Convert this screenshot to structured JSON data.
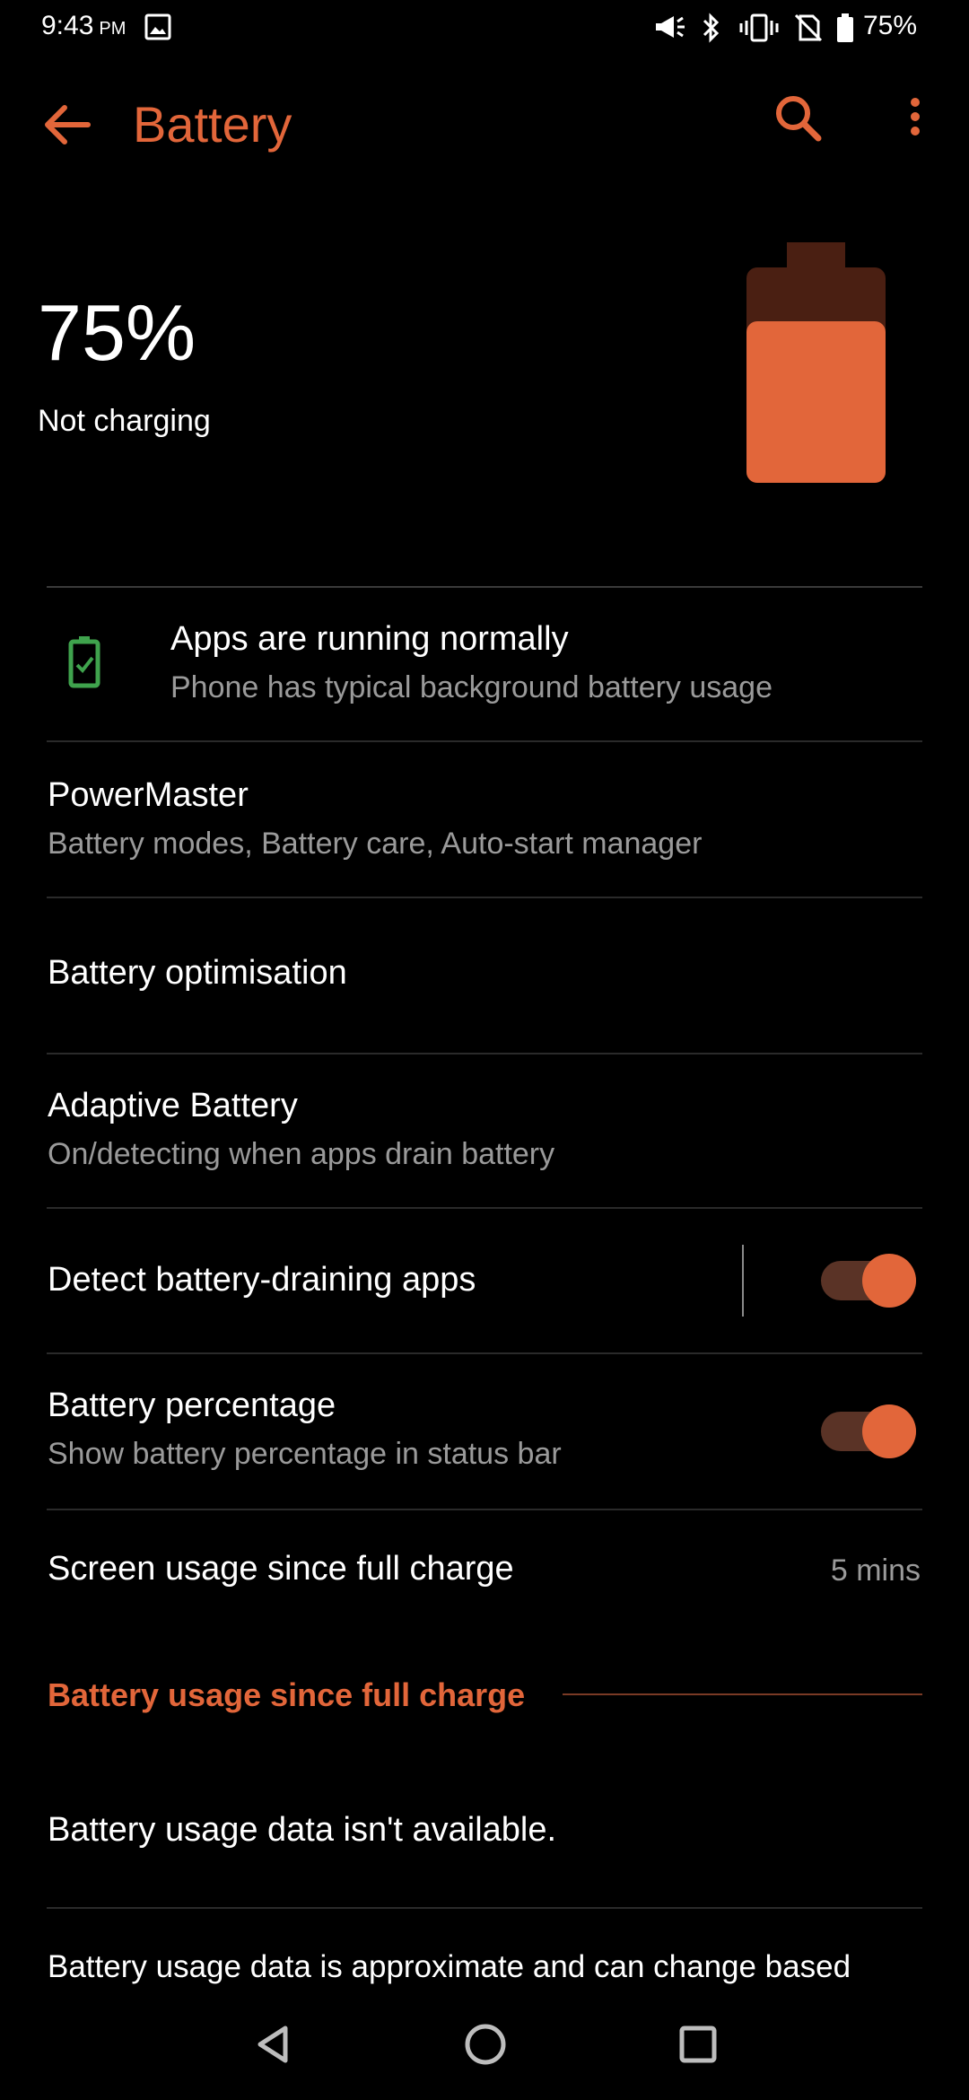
{
  "status_bar": {
    "time": "9:43",
    "ampm": "PM",
    "battery_text": "75%",
    "icons": [
      "gallery-icon",
      "megaphone-icon",
      "bluetooth-icon",
      "vibrate-icon",
      "no-sim-icon",
      "battery-icon"
    ]
  },
  "app_bar": {
    "title": "Battery",
    "accent_color": "#e2663a"
  },
  "battery": {
    "percent_text": "75%",
    "level": 0.75,
    "status": "Not charging"
  },
  "items": {
    "apps_running": {
      "title": "Apps are running normally",
      "subtitle": "Phone has typical background battery usage"
    },
    "powermaster": {
      "title": "PowerMaster",
      "subtitle": "Battery modes, Battery care, Auto-start manager"
    },
    "optimisation": {
      "title": "Battery optimisation"
    },
    "adaptive": {
      "title": "Adaptive Battery",
      "subtitle": "On/detecting when apps drain battery"
    },
    "detect_draining": {
      "title": "Detect battery-draining apps",
      "enabled": true
    },
    "percentage": {
      "title": "Battery percentage",
      "subtitle": "Show battery percentage in status bar",
      "enabled": true
    },
    "screen_usage": {
      "title": "Screen usage since full charge",
      "value": "5 mins"
    }
  },
  "section": {
    "header": "Battery usage since full charge",
    "no_data": "Battery usage data isn't available.",
    "footer": "Battery usage data is approximate and can change based"
  },
  "nav_bar": {
    "icons": [
      "back-triangle-icon",
      "home-circle-icon",
      "recents-square-icon"
    ]
  }
}
